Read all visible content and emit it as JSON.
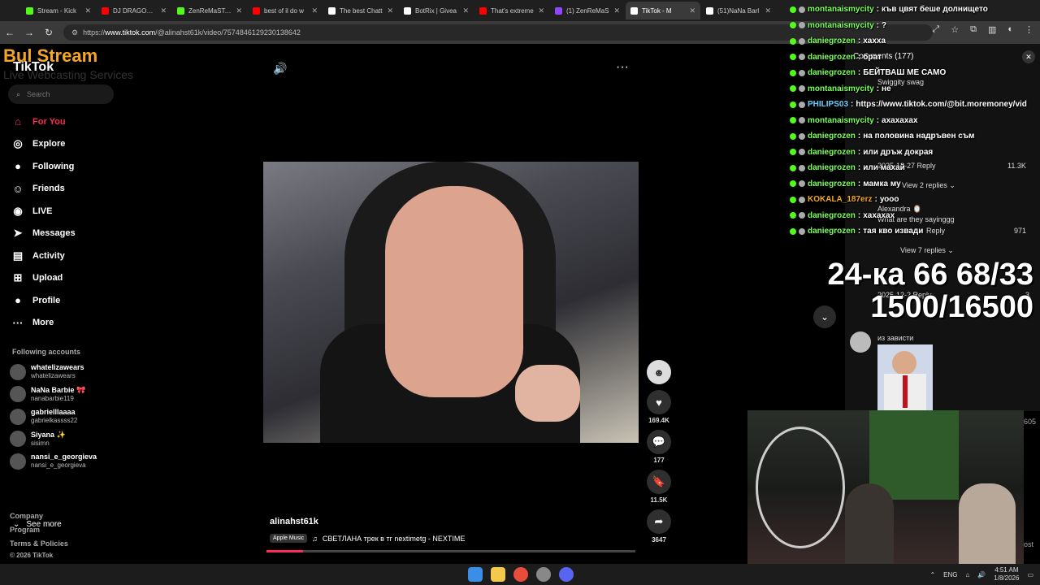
{
  "tabs": [
    {
      "title": "Stream - Kick",
      "color": "#53fc18"
    },
    {
      "title": "DJ DRAGOTIN",
      "color": "#ff0000"
    },
    {
      "title": "ZenReMaSTa V",
      "color": "#53fc18"
    },
    {
      "title": "best of il do w",
      "color": "#ff0000"
    },
    {
      "title": "The best Chatt",
      "color": "#ffffff"
    },
    {
      "title": "BotRix | Givea",
      "color": "#ffffff"
    },
    {
      "title": "That's extreme",
      "color": "#ff0000"
    },
    {
      "title": "(1) ZenReMaS",
      "color": "#9146ff"
    },
    {
      "title": "TikTok - M",
      "color": "#ffffff",
      "active": true
    },
    {
      "title": "(51)NaNa Barl",
      "color": "#ffffff"
    }
  ],
  "address": {
    "protocol": "https://",
    "host": "www.tiktok.com",
    "path": "/@alinahst61k/video/7574846129230138642"
  },
  "logo": {
    "main": "Bul Stream",
    "sub": "TikTok",
    "tagline": "Live Webcasting Services"
  },
  "search": {
    "placeholder": "Search"
  },
  "nav": [
    {
      "label": "For You",
      "icon": "⌂",
      "name": "home-icon"
    },
    {
      "label": "Explore",
      "icon": "◎",
      "name": "compass-icon"
    },
    {
      "label": "Following",
      "icon": "●",
      "name": "following-icon"
    },
    {
      "label": "Friends",
      "icon": "☺",
      "name": "friends-icon"
    },
    {
      "label": "LIVE",
      "icon": "◉",
      "name": "live-icon"
    },
    {
      "label": "Messages",
      "icon": "➤",
      "name": "messages-icon"
    },
    {
      "label": "Activity",
      "icon": "▤",
      "name": "activity-icon"
    },
    {
      "label": "Upload",
      "icon": "⊞",
      "name": "upload-icon"
    },
    {
      "label": "Profile",
      "icon": "●",
      "name": "profile-icon"
    },
    {
      "label": "More",
      "icon": "···",
      "name": "more-icon"
    }
  ],
  "following": {
    "title": "Following accounts",
    "accounts": [
      {
        "name": "whatelizawears",
        "handle": "whatelizawears"
      },
      {
        "name": "NaNa Barbie 🎀",
        "handle": "nanabarbie119"
      },
      {
        "name": "gabrielllaaaa",
        "handle": "gabrielkassss22"
      },
      {
        "name": "Siyana ✨",
        "handle": "sisimn"
      },
      {
        "name": "nansi_e_georgieva",
        "handle": "nansi_e_georgieva"
      }
    ],
    "see_more": "See more"
  },
  "footer": {
    "company": "Company",
    "program": "Program",
    "terms": "Terms & Policies",
    "copyright": "© 2026 TikTok"
  },
  "video": {
    "author": "alinahst61k",
    "music_badge": "Apple Music",
    "music": "СВЕТЛАНА трек в тг nextimetg - NEXTIME",
    "progress": 0.1,
    "likes": "169.4K",
    "comments": "177",
    "saves": "11.5K",
    "shares": "3647"
  },
  "comments": {
    "title": "Comments (177)",
    "items": [
      {
        "text": "Swiggity swag"
      },
      {
        "meta": "2025-12-27  Reply",
        "likes": "11.3K"
      },
      {
        "text": "View 2 replies ⌄"
      },
      {
        "author": "Alexandra 🪞",
        "text": "What are they sayinggg"
      },
      {
        "meta": "Reply",
        "likes": "971"
      },
      {
        "text": "View 7 replies ⌄"
      },
      {
        "meta": "2025-12-2  Reply",
        "likes": "3"
      },
      {
        "text": "из зависти"
      }
    ]
  },
  "chat": [
    {
      "user": "montanaismycity",
      "msg": "къв цвят беше долнището",
      "color": "#7bff5b"
    },
    {
      "user": "montanaismycity",
      "msg": "?",
      "color": "#7bff5b"
    },
    {
      "user": "daniegrozen",
      "msg": "хахха",
      "color": "#7bff5b"
    },
    {
      "user": "daniegrozen",
      "msg": "брат",
      "color": "#7bff5b"
    },
    {
      "user": "daniegrozen",
      "msg": "БЕЙТВАШ МЕ САМО",
      "color": "#7bff5b"
    },
    {
      "user": "montanaismycity",
      "msg": "не",
      "color": "#7bff5b"
    },
    {
      "user": "PHILIPS03",
      "msg": "https://www.tiktok.com/@bit.moremoney/vid",
      "color": "#6ad0ff"
    },
    {
      "user": "montanaismycity",
      "msg": "ахахахах",
      "color": "#7bff5b"
    },
    {
      "user": "daniegrozen",
      "msg": "на половина надръвен съм",
      "color": "#7bff5b"
    },
    {
      "user": "daniegrozen",
      "msg": "или дръж докрая",
      "color": "#7bff5b"
    },
    {
      "user": "daniegrozen",
      "msg": "или махай",
      "color": "#7bff5b"
    },
    {
      "user": "daniegrozen",
      "msg": "мамка му",
      "color": "#7bff5b"
    },
    {
      "user": "KOKALA_187erz",
      "msg": "уооо",
      "color": "#f5a623"
    },
    {
      "user": "daniegrozen",
      "msg": "хахахах",
      "color": "#7bff5b"
    },
    {
      "user": "daniegrozen",
      "msg": "тая кво извади",
      "color": "#7bff5b"
    }
  ],
  "overlay": {
    "line1": "24-ка 66 68/33",
    "line2": "1500/16500"
  },
  "side_numbers": {
    "a": "605",
    "b": "ost"
  },
  "taskbar": {
    "lang": "ENG",
    "time": "4:51 AM",
    "date": "1/8/2026"
  }
}
